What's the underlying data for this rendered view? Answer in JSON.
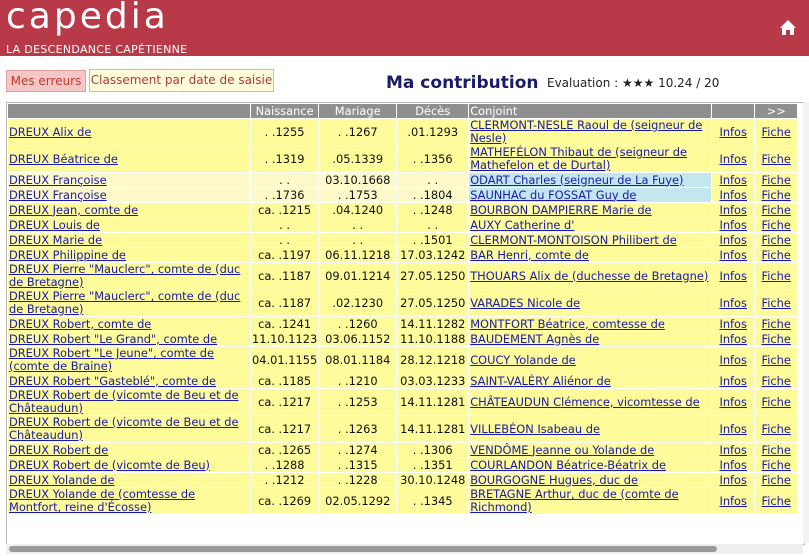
{
  "header": {
    "logo": "capedia",
    "subtitle": "LA DESCENDANCE CAPÉTIENNE"
  },
  "toolbar": {
    "errors_label": "Mes erreurs",
    "sort_label": "Classement par date de saisie"
  },
  "page": {
    "title": "Ma contribution",
    "evaluation": "Evaluation : ★★★ 10.24 / 20"
  },
  "table": {
    "headers": [
      "",
      "Naissance",
      "Mariage",
      "Décès",
      "Conjoint",
      "",
      ">>"
    ],
    "rows": [
      {
        "name": "DREUX Alix de",
        "birth": ". .1255",
        "marriage": ". .1267",
        "death": ".01.1293",
        "spouse": "CLERMONT-NESLE Raoul de (seigneur de Nesle)",
        "infos": "Infos",
        "fiche": "Fiche",
        "alt": false
      },
      {
        "name": "DREUX Béatrice de",
        "birth": ". .1319",
        "marriage": ".05.1339",
        "death": ". .1356",
        "spouse": "MATHEFÉLON Thibaut de (seigneur de Mathefelon et de Durtal)",
        "infos": "Infos",
        "fiche": "Fiche",
        "alt": false
      },
      {
        "name": "DREUX Françoise",
        "birth": ". .",
        "marriage": "03.10.1668",
        "death": ". .",
        "spouse": "ODART Charles (seigneur de La Fuye)",
        "infos": "Infos",
        "fiche": "Fiche",
        "alt": true
      },
      {
        "name": "DREUX Françoise",
        "birth": ". .1736",
        "marriage": ". .1753",
        "death": ". .1804",
        "spouse": "SAUNHAC du FOSSAT Guy de",
        "infos": "Infos",
        "fiche": "Fiche",
        "alt": true
      },
      {
        "name": "DREUX Jean, comte de",
        "birth": "ca. .1215",
        "marriage": ".04.1240",
        "death": ". .1248",
        "spouse": "BOURBON DAMPIERRE Marie de",
        "infos": "Infos",
        "fiche": "Fiche",
        "alt": false
      },
      {
        "name": "DREUX Louis de",
        "birth": ". .",
        "marriage": ". .",
        "death": ". .",
        "spouse": "AUXY Catherine d'",
        "infos": "Infos",
        "fiche": "Fiche",
        "alt": false
      },
      {
        "name": "DREUX Marie de",
        "birth": ". .",
        "marriage": ". .",
        "death": ". .1501",
        "spouse": "CLERMONT-MONTOISON Philibert de",
        "infos": "Infos",
        "fiche": "Fiche",
        "alt": false
      },
      {
        "name": "DREUX Philippine de",
        "birth": "ca. .1197",
        "marriage": "06.11.1218",
        "death": "17.03.1242",
        "spouse": "BAR Henri, comte de",
        "infos": "Infos",
        "fiche": "Fiche",
        "alt": false
      },
      {
        "name": "DREUX Pierre \"Mauclerc\", comte de (duc de Bretagne)",
        "birth": "ca. .1187",
        "marriage": "09.01.1214",
        "death": "27.05.1250",
        "spouse": "THOUARS Alix de (duchesse de Bretagne)",
        "infos": "Infos",
        "fiche": "Fiche",
        "alt": false
      },
      {
        "name": "DREUX Pierre \"Mauclerc\", comte de (duc de Bretagne)",
        "birth": "ca. .1187",
        "marriage": ".02.1230",
        "death": "27.05.1250",
        "spouse": "VARADES Nicole de",
        "infos": "Infos",
        "fiche": "Fiche",
        "alt": false
      },
      {
        "name": "DREUX Robert, comte de",
        "birth": "ca. .1241",
        "marriage": ". .1260",
        "death": "14.11.1282",
        "spouse": "MONTFORT Béatrice, comtesse de",
        "infos": "Infos",
        "fiche": "Fiche",
        "alt": false
      },
      {
        "name": "DREUX Robert \"Le Grand\", comte de",
        "birth": "11.10.1123",
        "marriage": "03.06.1152",
        "death": "11.10.1188",
        "spouse": "BAUDEMENT Agnès de",
        "infos": "Infos",
        "fiche": "Fiche",
        "alt": false
      },
      {
        "name": "DREUX Robert \"Le Jeune\", comte de (comte de Braine)",
        "birth": "04.01.1155",
        "marriage": "08.01.1184",
        "death": "28.12.1218",
        "spouse": "COUCY Yolande de",
        "infos": "Infos",
        "fiche": "Fiche",
        "alt": false
      },
      {
        "name": "DREUX Robert \"Gasteblé\", comte de",
        "birth": "ca. .1185",
        "marriage": ". .1210",
        "death": "03.03.1233",
        "spouse": "SAINT-VALÉRY Aliénor de",
        "infos": "Infos",
        "fiche": "Fiche",
        "alt": false
      },
      {
        "name": "DREUX Robert de (vicomte de Beu et de Châteaudun)",
        "birth": "ca. .1217",
        "marriage": ". .1253",
        "death": "14.11.1281",
        "spouse": "CHÂTEAUDUN Clémence, vicomtesse de",
        "infos": "Infos",
        "fiche": "Fiche",
        "alt": false
      },
      {
        "name": "DREUX Robert de (vicomte de Beu et de Châteaudun)",
        "birth": "ca. .1217",
        "marriage": ". .1263",
        "death": "14.11.1281",
        "spouse": "VILLEBÉON Isabeau de",
        "infos": "Infos",
        "fiche": "Fiche",
        "alt": false
      },
      {
        "name": "DREUX Robert de",
        "birth": "ca. .1265",
        "marriage": ". .1274",
        "death": ". .1306",
        "spouse": "VENDÔME Jeanne ou Yolande de",
        "infos": "Infos",
        "fiche": "Fiche",
        "alt": false
      },
      {
        "name": "DREUX Robert de (vicomte de Beu)",
        "birth": ". .1288",
        "marriage": ". .1315",
        "death": ". .1351",
        "spouse": "COURLANDON Béatrice-Béatrix de",
        "infos": "Infos",
        "fiche": "Fiche",
        "alt": false
      },
      {
        "name": "DREUX Yolande de",
        "birth": ". .1212",
        "marriage": ". .1228",
        "death": "30.10.1248",
        "spouse": "BOURGOGNE Hugues, duc de",
        "infos": "Infos",
        "fiche": "Fiche",
        "alt": false
      },
      {
        "name": "DREUX Yolande de (comtesse de Montfort, reine d'Écosse)",
        "birth": "ca. .1269",
        "marriage": "02.05.1292",
        "death": ". .1345",
        "spouse": "BRETAGNE Arthur, duc de (comte de Richmond)",
        "infos": "Infos",
        "fiche": "Fiche",
        "alt": false
      }
    ]
  },
  "colors": {
    "header_bg": "#b83a48",
    "row_bg": "#fdfb9a",
    "highlight_bg": "#c3e6ef",
    "link": "#1a1aa6"
  }
}
